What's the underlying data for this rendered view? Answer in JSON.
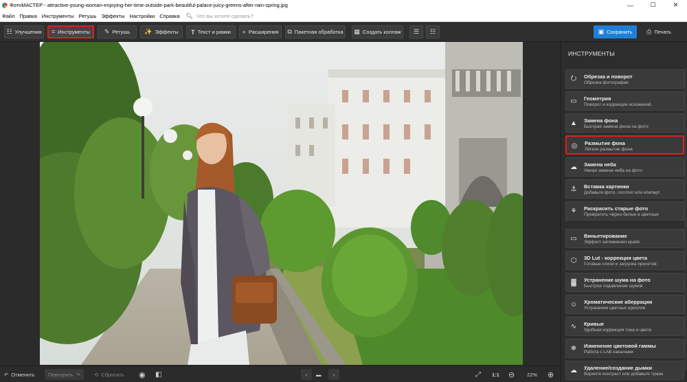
{
  "window": {
    "title": "ФотоМАСТЕР - attractive-young-woman-enjoying-her-time-outside-park-beautiful-palace-juicy-greens-after-rain-spring.jpg",
    "minimize": "—",
    "maximize": "☐",
    "close": "✕"
  },
  "menu": {
    "items": [
      "Файл",
      "Правка",
      "Инструменты",
      "Ретушь",
      "Эффекты",
      "Настройки",
      "Справка"
    ],
    "search_placeholder": "Что вы хотите сделать?"
  },
  "toolbar": {
    "improve": "Улучшения",
    "tools": "Инструменты",
    "retouch": "Ретушь",
    "effects": "Эффекты",
    "text": "Текст и рамки",
    "extensions": "Расширения",
    "batch": "Пакетная обработка",
    "collage": "Создать коллаж",
    "save": "Сохранить",
    "print": "Печать"
  },
  "bottom": {
    "undo": "Отменить",
    "redo": "Повторить",
    "reset": "Сбросить",
    "ratio": "1:1",
    "zoom": "22%"
  },
  "panel": {
    "title": "ИНСТРУМЕНТЫ",
    "tools": [
      {
        "name": "Обрезка и поворот",
        "desc": "Обрезка фотографии",
        "icon": "crop-rotate-icon"
      },
      {
        "name": "Геометрия",
        "desc": "Поворот и коррекция искажений",
        "icon": "geometry-icon"
      },
      {
        "name": "Замена фона",
        "desc": "Быстрая замена фона на фото",
        "icon": "background-replace-icon"
      },
      {
        "name": "Размытие фона",
        "desc": "Лёгкое размытие фона",
        "icon": "background-blur-icon"
      },
      {
        "name": "Замена неба",
        "desc": "Умная замена неба на фото",
        "icon": "sky-replace-icon"
      },
      {
        "name": "Вставка картинки",
        "desc": "Добавьте фото, логотип или клипарт",
        "icon": "insert-image-icon"
      },
      {
        "name": "Раскрасить старые фото",
        "desc": "Превратить чёрно-белые в цветные",
        "icon": "colorize-icon"
      },
      {
        "name": "Виньетирование",
        "desc": "Эффект затемнения краёв",
        "icon": "vignette-icon"
      },
      {
        "name": "3D Lut - коррекция цвета",
        "desc": "Готовые стили и загрузка пресетов",
        "icon": "lut-icon"
      },
      {
        "name": "Устранение шума на фото",
        "desc": "Быстрое подавление шумов",
        "icon": "denoise-icon"
      },
      {
        "name": "Хроматические аберрации",
        "desc": "Устранение цветных ореолов",
        "icon": "chromatic-icon"
      },
      {
        "name": "Кривые",
        "desc": "Удобная коррекция тона и цвета",
        "icon": "curves-icon"
      },
      {
        "name": "Изменение цветовой гаммы",
        "desc": "Работа с LAB каналами",
        "icon": "color-gamut-icon"
      },
      {
        "name": "Удаление/создание дымки",
        "desc": "Верните контраст или добавьте туман",
        "icon": "dehaze-icon"
      }
    ]
  },
  "colors": {
    "accent_red": "#e02020",
    "save_blue": "#1e7fd6"
  }
}
